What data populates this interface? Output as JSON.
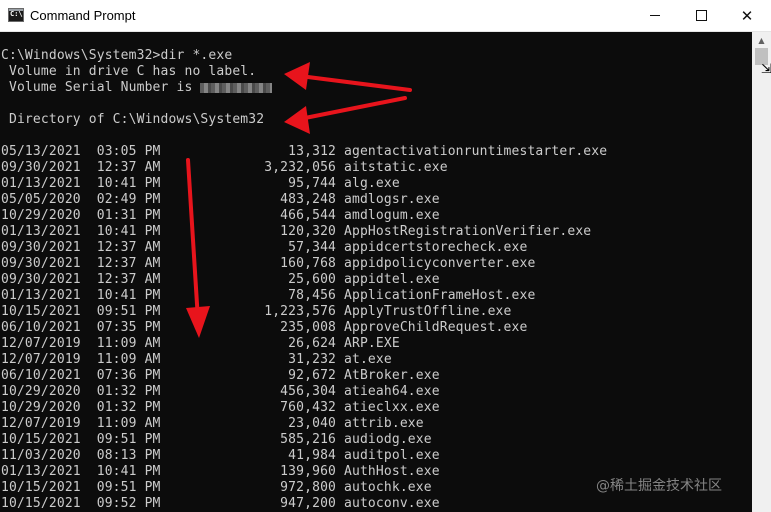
{
  "window": {
    "title": "Command Prompt"
  },
  "header_lines": [
    "C:\\Windows\\System32>dir *.exe",
    " Volume in drive C has no label.",
    " Volume Serial Number is ",
    "",
    " Directory of C:\\Windows\\System32",
    ""
  ],
  "files": [
    {
      "date": "05/13/2021",
      "time": "03:05 PM",
      "size": "13,312",
      "name": "agentactivationruntimestarter.exe"
    },
    {
      "date": "09/30/2021",
      "time": "12:37 AM",
      "size": "3,232,056",
      "name": "aitstatic.exe"
    },
    {
      "date": "01/13/2021",
      "time": "10:41 PM",
      "size": "95,744",
      "name": "alg.exe"
    },
    {
      "date": "05/05/2020",
      "time": "02:49 PM",
      "size": "483,248",
      "name": "amdlogsr.exe"
    },
    {
      "date": "10/29/2020",
      "time": "01:31 PM",
      "size": "466,544",
      "name": "amdlogum.exe"
    },
    {
      "date": "01/13/2021",
      "time": "10:41 PM",
      "size": "120,320",
      "name": "AppHostRegistrationVerifier.exe"
    },
    {
      "date": "09/30/2021",
      "time": "12:37 AM",
      "size": "57,344",
      "name": "appidcertstorecheck.exe"
    },
    {
      "date": "09/30/2021",
      "time": "12:37 AM",
      "size": "160,768",
      "name": "appidpolicyconverter.exe"
    },
    {
      "date": "09/30/2021",
      "time": "12:37 AM",
      "size": "25,600",
      "name": "appidtel.exe"
    },
    {
      "date": "01/13/2021",
      "time": "10:41 PM",
      "size": "78,456",
      "name": "ApplicationFrameHost.exe"
    },
    {
      "date": "10/15/2021",
      "time": "09:51 PM",
      "size": "1,223,576",
      "name": "ApplyTrustOffline.exe"
    },
    {
      "date": "06/10/2021",
      "time": "07:35 PM",
      "size": "235,008",
      "name": "ApproveChildRequest.exe"
    },
    {
      "date": "12/07/2019",
      "time": "11:09 AM",
      "size": "26,624",
      "name": "ARP.EXE"
    },
    {
      "date": "12/07/2019",
      "time": "11:09 AM",
      "size": "31,232",
      "name": "at.exe"
    },
    {
      "date": "06/10/2021",
      "time": "07:36 PM",
      "size": "92,672",
      "name": "AtBroker.exe"
    },
    {
      "date": "10/29/2020",
      "time": "01:32 PM",
      "size": "456,304",
      "name": "atieah64.exe"
    },
    {
      "date": "10/29/2020",
      "time": "01:32 PM",
      "size": "760,432",
      "name": "atieclxx.exe"
    },
    {
      "date": "12/07/2019",
      "time": "11:09 AM",
      "size": "23,040",
      "name": "attrib.exe"
    },
    {
      "date": "10/15/2021",
      "time": "09:51 PM",
      "size": "585,216",
      "name": "audiodg.exe"
    },
    {
      "date": "11/03/2020",
      "time": "08:13 PM",
      "size": "41,984",
      "name": "auditpol.exe"
    },
    {
      "date": "01/13/2021",
      "time": "10:41 PM",
      "size": "139,960",
      "name": "AuthHost.exe"
    },
    {
      "date": "10/15/2021",
      "time": "09:51 PM",
      "size": "972,800",
      "name": "autochk.exe"
    },
    {
      "date": "10/15/2021",
      "time": "09:52 PM",
      "size": "947,200",
      "name": "autoconv.exe"
    }
  ],
  "watermark": "@稀土掘金技术社区",
  "colors": {
    "console_bg": "#0c0c0c",
    "console_text": "#cccccc",
    "annotation_arrow": "#e8141c"
  }
}
